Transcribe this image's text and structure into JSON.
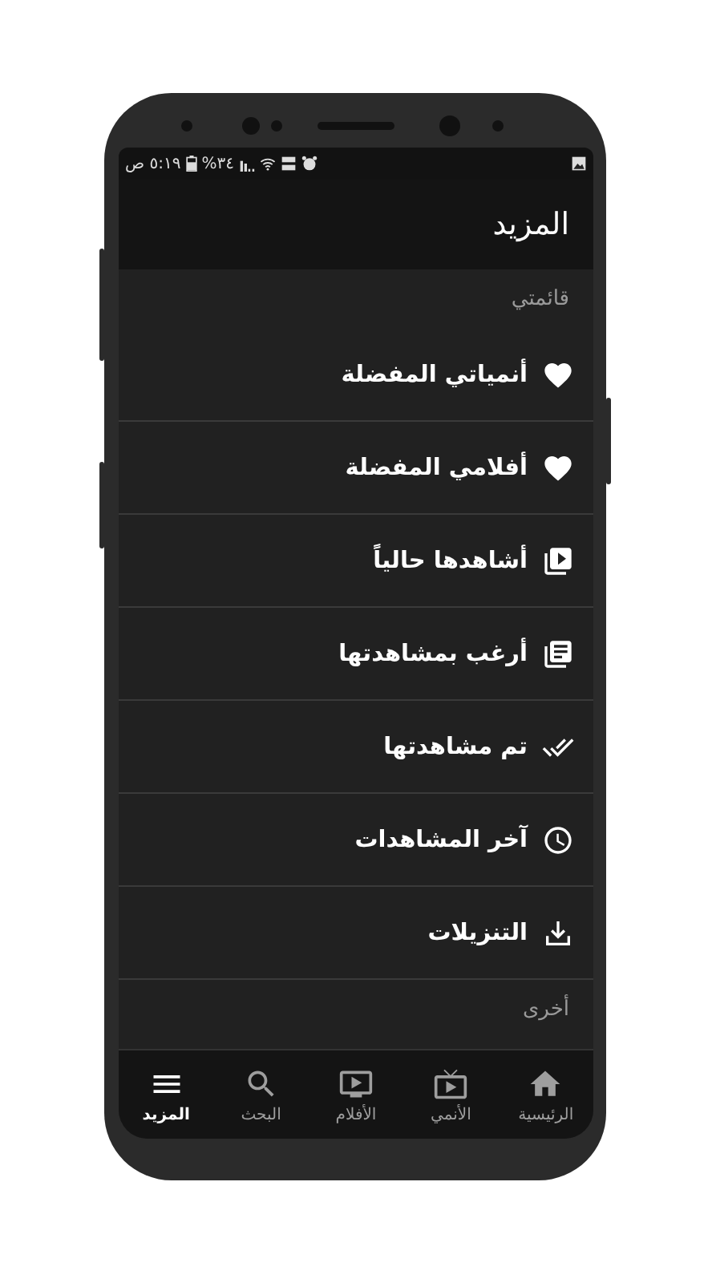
{
  "status_bar": {
    "time": "٥:١٩ ص",
    "battery": "%٣٤"
  },
  "header": {
    "title": "المزيد"
  },
  "sections": [
    {
      "title": "قائمتي",
      "items": [
        {
          "label": "أنمياتي المفضلة"
        },
        {
          "label": "أفلامي المفضلة"
        },
        {
          "label": "أشاهدها حالياً"
        },
        {
          "label": "أرغب بمشاهدتها"
        },
        {
          "label": "تم مشاهدتها"
        },
        {
          "label": "آخر المشاهدات"
        },
        {
          "label": "التنزيلات"
        }
      ]
    },
    {
      "title": "أخرى"
    }
  ],
  "bottom_nav": [
    {
      "label": "الرئيسية",
      "selected": false
    },
    {
      "label": "الأنمي",
      "selected": false
    },
    {
      "label": "الأفلام",
      "selected": false
    },
    {
      "label": "البحث",
      "selected": false
    },
    {
      "label": "المزيد",
      "selected": true
    }
  ]
}
